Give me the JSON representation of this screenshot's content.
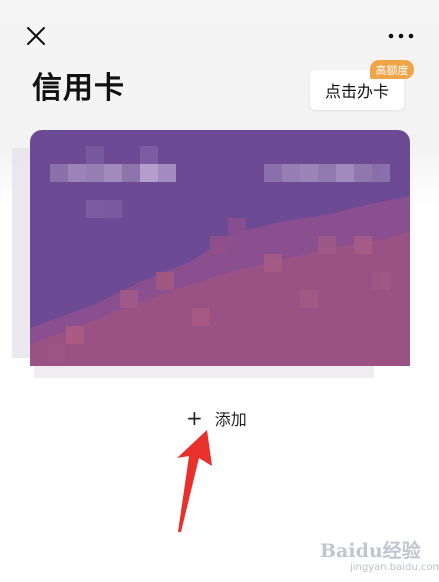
{
  "header": {
    "title": "信用卡",
    "close_icon": "close-icon",
    "more_icon": "more-icon"
  },
  "promo": {
    "apply_label": "点击办卡",
    "badge_label": "高额度",
    "badge_color": "#f0a448"
  },
  "card": {
    "color_primary": "#6d4a94",
    "color_accent": "#a3577f"
  },
  "actions": {
    "add_icon": "plus-icon",
    "add_label": "添加"
  },
  "annotation": {
    "arrow_color": "#e8312b"
  },
  "watermark": {
    "brand_text": "Baidu经验",
    "site_text": "jingyan.baidu.com"
  }
}
